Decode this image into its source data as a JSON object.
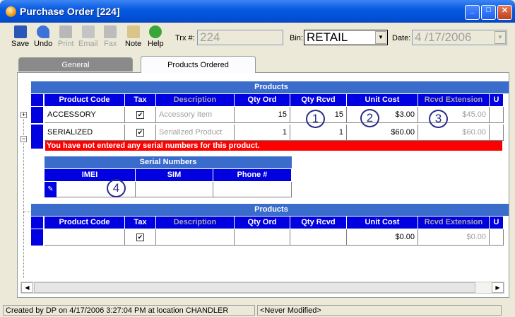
{
  "window": {
    "title": "Purchase Order [224]",
    "controls": {
      "minimize": "_",
      "maximize": "□",
      "close": "✕"
    }
  },
  "toolbar": {
    "buttons": [
      {
        "label": "Save",
        "icon": "floppy-icon",
        "enabled": true
      },
      {
        "label": "Undo",
        "icon": "undo-arrow-icon",
        "enabled": true
      },
      {
        "label": "Print",
        "icon": "printer-icon",
        "enabled": false
      },
      {
        "label": "Email",
        "icon": "email-icon",
        "enabled": false
      },
      {
        "label": "Fax",
        "icon": "fax-icon",
        "enabled": false
      },
      {
        "label": "Note",
        "icon": "note-icon",
        "enabled": true
      },
      {
        "label": "Help",
        "icon": "help-question-icon",
        "enabled": true
      }
    ],
    "trx_label": "Trx #:",
    "trx_value": "224",
    "bin_label": "Bin:",
    "bin_value": "RETAIL",
    "date_label": "Date:",
    "date_value": "4 /17/2006"
  },
  "tabs": [
    {
      "label": "General"
    },
    {
      "label": "Products Ordered"
    }
  ],
  "products_band": "Products",
  "columns": [
    "Product Code",
    "Tax",
    "Description",
    "Qty Ord",
    "Qty Rcvd",
    "Unit Cost",
    "Rcvd Extension",
    "U"
  ],
  "rows": [
    {
      "code": "ACCESSORY",
      "tax": "✔",
      "description": "Accessory Item",
      "qty_ord": "15",
      "qty_rcvd": "15",
      "unit_cost": "$3.00",
      "rcvd_ext": "$45.00",
      "expander": "+"
    },
    {
      "code": "SERIALIZED",
      "tax": "✔",
      "description": "Serialized Product",
      "qty_ord": "1",
      "qty_rcvd": "1",
      "unit_cost": "$60.00",
      "rcvd_ext": "$60.00",
      "expander": "−"
    }
  ],
  "error_message": "You have not entered any serial numbers for this product.",
  "serial": {
    "band": "Serial Numbers",
    "columns": [
      "IMEI",
      "SIM",
      "Phone #"
    ],
    "edit_indicator": "✎"
  },
  "products2": {
    "band": "Products",
    "row": {
      "tax": "✔",
      "unit_cost": "$0.00",
      "rcvd_ext": "$0.00"
    }
  },
  "callouts": [
    "1",
    "2",
    "3",
    "4"
  ],
  "scroll": {
    "left": "◀",
    "right": "▶"
  },
  "status": {
    "created": "Created by DP on 4/17/2006 3:27:04 PM at location CHANDLER",
    "modified": "<Never Modified>"
  }
}
